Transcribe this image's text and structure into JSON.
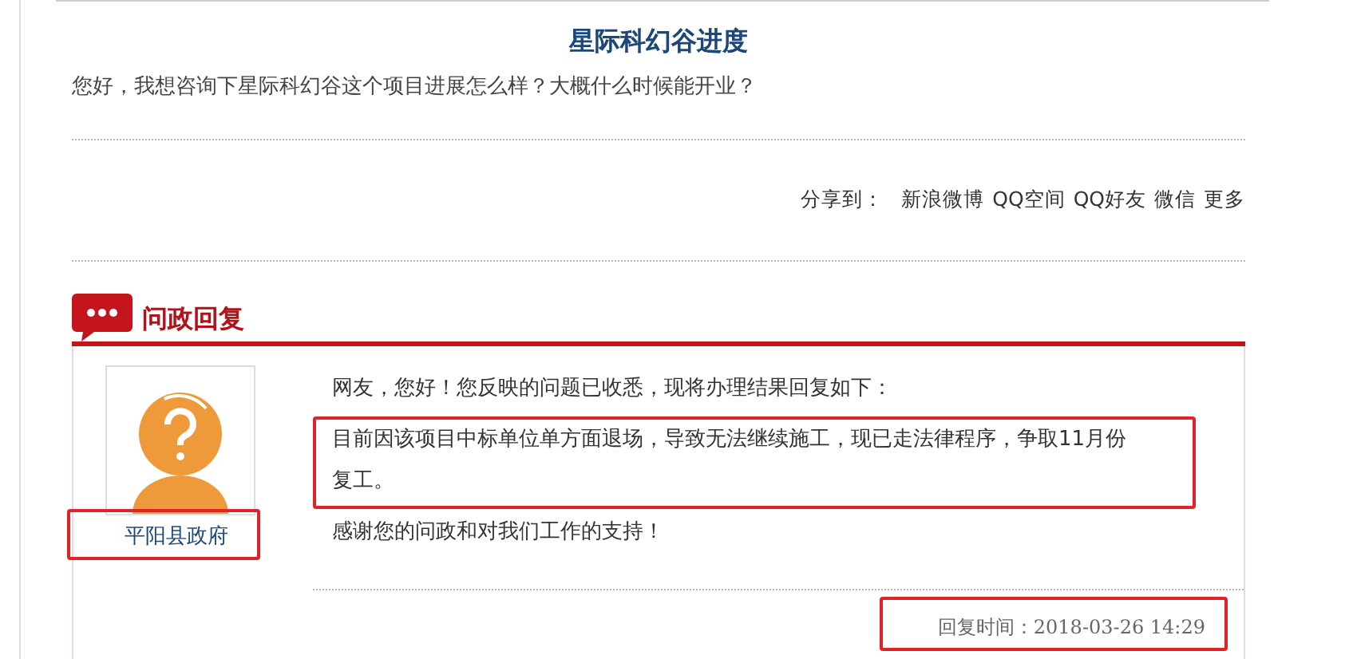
{
  "title": "星际科幻谷进度",
  "question": "您好，我想咨询下星际科幻谷这个项目进展怎么样？大概什么时候能开业？",
  "share": {
    "label": "分享到：",
    "links": [
      "新浪微博",
      "QQ空间",
      "QQ好友",
      "微信",
      "更多"
    ]
  },
  "section_title": "问政回复",
  "reply": {
    "author": "平阳县政府",
    "author_highlighted": true,
    "lines": [
      {
        "text": "网友，您好！您反映的问题已收悉，现将办理结果回复如下：",
        "highlighted": false
      },
      {
        "text": "目前因该项目中标单位单方面退场，导致无法继续施工，现已走法律程序，争取11月份复工。",
        "highlighted": true
      },
      {
        "text": "感谢您的问政和对我们工作的支持！",
        "highlighted": false
      }
    ],
    "time": "回复时间：2018-03-26 14:29",
    "time_highlighted": true
  }
}
